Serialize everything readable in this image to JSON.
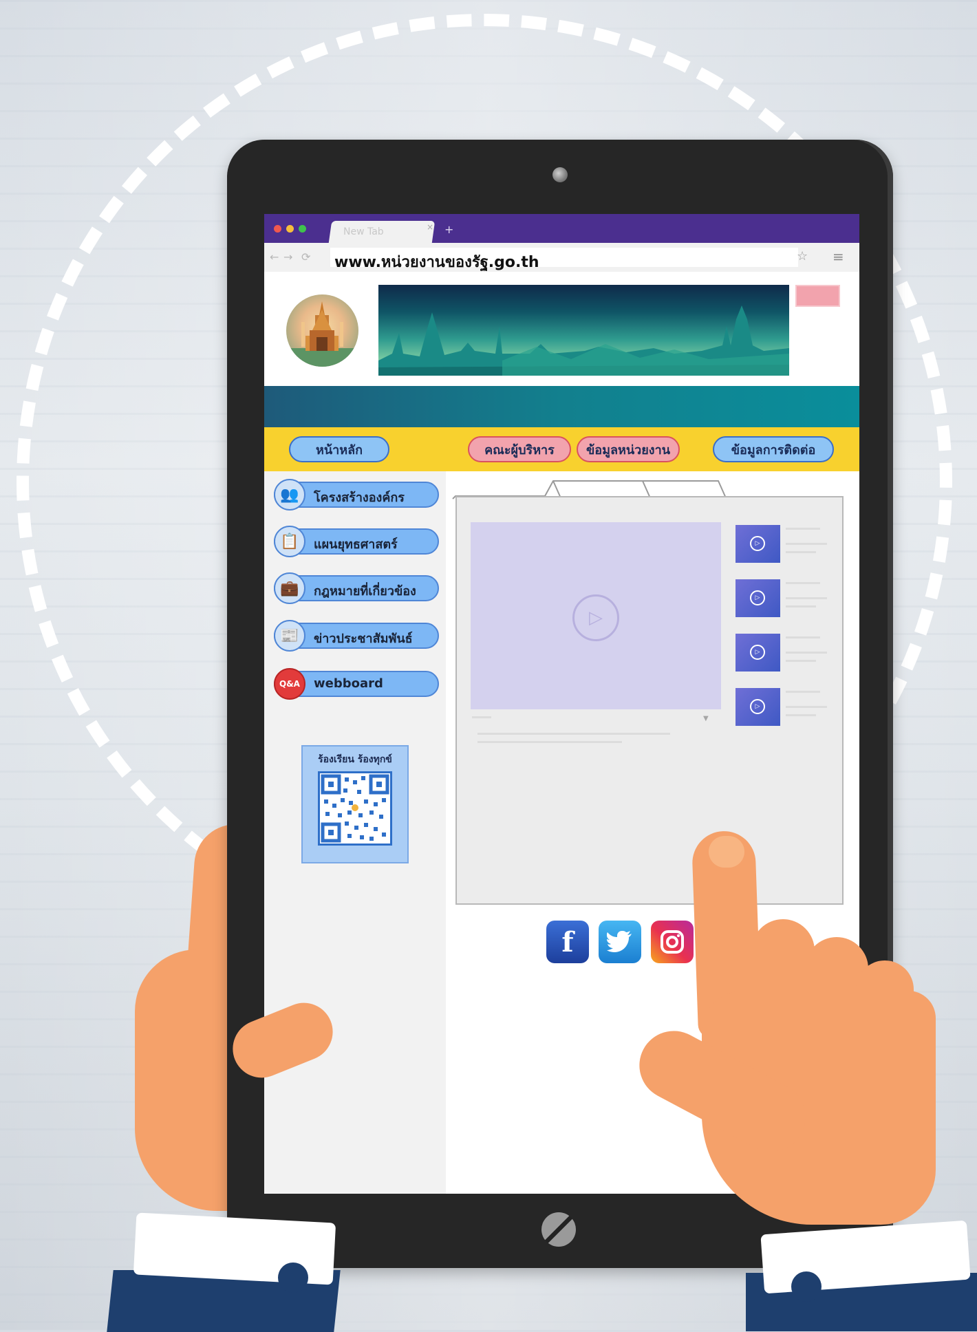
{
  "browser": {
    "tab_label": "New Tab",
    "tab_close": "×",
    "new_tab": "+",
    "nav_back": "←",
    "nav_forward": "→",
    "nav_reload": "⟳",
    "url": "www.หน่วยงานของรัฐ.go.th",
    "icons": [
      "star-icon",
      "menu-icon",
      "back-arrow-icon",
      "forward-arrow-icon",
      "reload-icon",
      "close-icon",
      "plus-icon"
    ]
  },
  "nav": {
    "home": "หน้าหลัก",
    "executives": "คณะผู้บริหาร",
    "agency_info": "ข้อมูลหน่วยงาน",
    "contact": "ข้อมูลการติดต่อ"
  },
  "sidebar": {
    "items": [
      {
        "label": "โครงสร้างองค์กร",
        "icon": "org-chart-icon",
        "glyph": "👥"
      },
      {
        "label": "แผนยุทธศาสตร์",
        "icon": "strategy-board-icon",
        "glyph": "📋"
      },
      {
        "label": "กฎหมายที่เกี่ยวข้อง",
        "icon": "briefcase-icon",
        "glyph": "💼"
      },
      {
        "label": "ข่าวประชาสัมพันธ์",
        "icon": "news-document-icon",
        "glyph": "📰"
      },
      {
        "label": "webboard",
        "icon": "qa-bubble-icon",
        "glyph": "Q&A"
      }
    ],
    "complaint": {
      "title": "ร้องเรียน ร้องทุกข์",
      "icon": "qr-code-icon"
    }
  },
  "media": {
    "main_play_icon": "play-icon",
    "thumbnails_count": 4,
    "play_glyph": "▷"
  },
  "social": {
    "facebook": "f",
    "twitter": "twitter-bird-icon",
    "instagram": "instagram-icon",
    "line": "line-icon"
  },
  "colors": {
    "tabbar": "#4b2f8f",
    "nav_yellow": "#f8d12e",
    "teal": "#0a8e9b",
    "sidebar_button": "#7db7f5",
    "executives_button": "#f2a3ad",
    "nav_blue": "#8ec4f5"
  }
}
